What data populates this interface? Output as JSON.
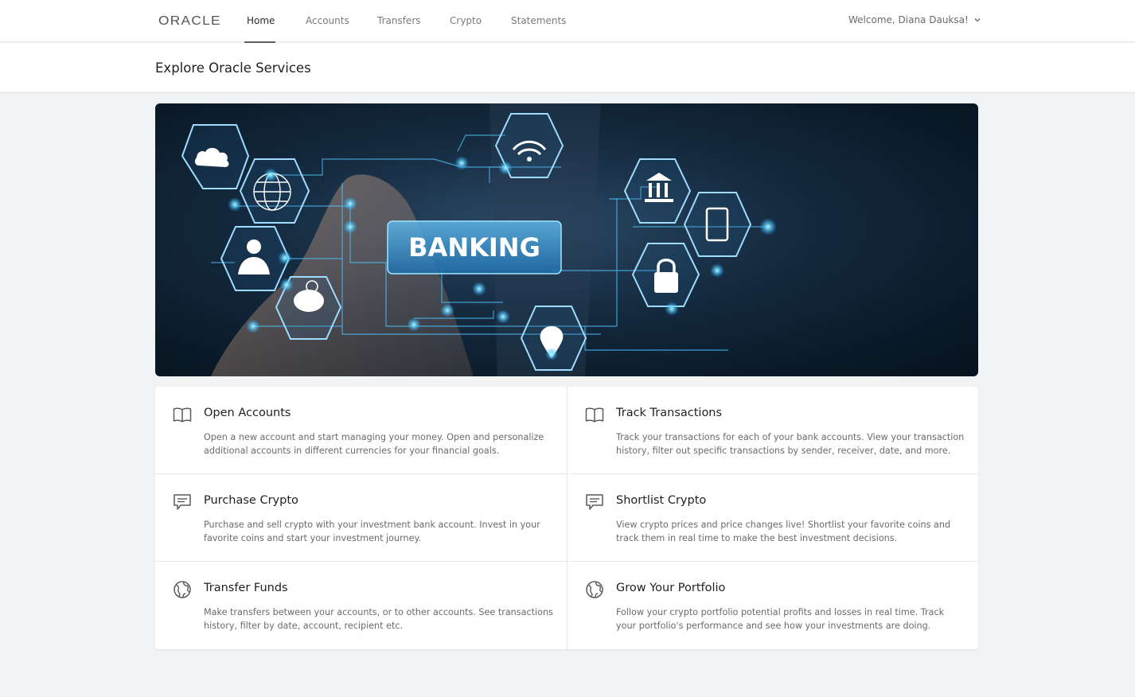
{
  "brand": {
    "logo_text": "ORACLE"
  },
  "nav": {
    "items": [
      {
        "label": "Home",
        "active": true
      },
      {
        "label": "Accounts",
        "active": false
      },
      {
        "label": "Transfers",
        "active": false
      },
      {
        "label": "Crypto",
        "active": false
      },
      {
        "label": "Statements",
        "active": false
      }
    ],
    "welcome": "Welcome, Diana Dauksa!"
  },
  "page": {
    "title": "Explore Oracle Services"
  },
  "banner": {
    "text": "BANKING"
  },
  "features": [
    {
      "title": "Open Accounts",
      "icon": "book-icon",
      "description": "Open a new account and start managing your money. Open and personalize additional accounts in different currencies for your financial goals."
    },
    {
      "title": "Track Transactions",
      "icon": "book-icon",
      "description": "Track your transactions for each of your bank accounts. View your transaction history, filter out specific transactions by sender, receiver, date, and more."
    },
    {
      "title": "Purchase Crypto",
      "icon": "message-icon",
      "description": "Purchase and sell crypto with your investment bank account. Invest in your favorite coins and start your investment journey."
    },
    {
      "title": "Shortlist Crypto",
      "icon": "message-icon",
      "description": "View crypto prices and price changes live! Shortlist your favorite coins and track them in real time to make the best investment decisions."
    },
    {
      "title": "Transfer Funds",
      "icon": "globe-icon",
      "description": "Make transfers between your accounts, or to other accounts. See transactions history, filter by date, account, recipient etc."
    },
    {
      "title": "Grow Your Portfolio",
      "icon": "globe-icon",
      "description": "Follow your crypto portfolio potential profits and losses in real time. Track your portfolio's performance and see how your investments are doing."
    }
  ]
}
